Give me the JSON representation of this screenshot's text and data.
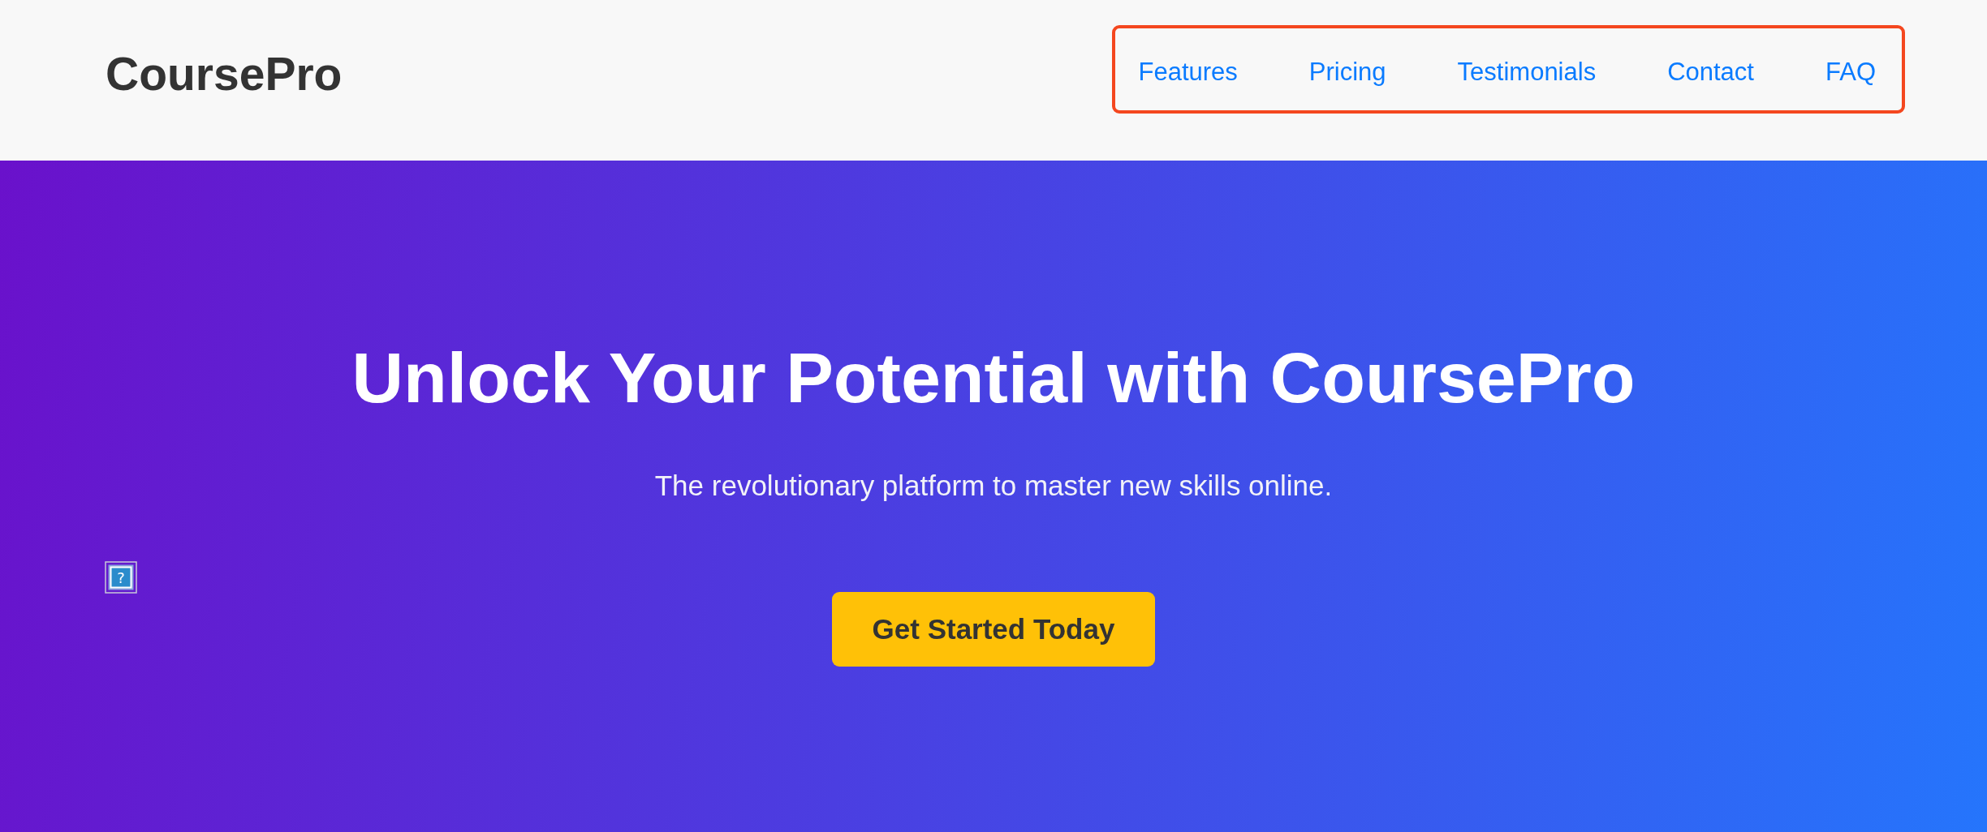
{
  "header": {
    "logo": "CoursePro",
    "nav": {
      "highlighted": true,
      "items": [
        {
          "label": "Features"
        },
        {
          "label": "Pricing"
        },
        {
          "label": "Testimonials"
        },
        {
          "label": "Contact"
        },
        {
          "label": "FAQ"
        }
      ]
    }
  },
  "hero": {
    "broken_image": {
      "glyph": "?"
    },
    "title": "Unlock Your Potential with CoursePro",
    "subtitle": "The revolutionary platform to master new skills online.",
    "cta": "Get Started Today"
  }
}
